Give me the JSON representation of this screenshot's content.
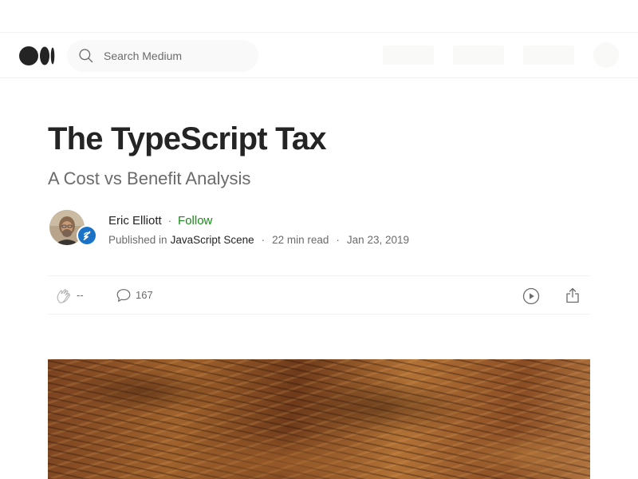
{
  "header": {
    "logo": "medium-logo",
    "search": {
      "placeholder": "Search Medium"
    }
  },
  "article": {
    "title": "The TypeScript Tax",
    "subtitle": "A Cost vs Benefit Analysis",
    "author": {
      "name": "Eric Elliott",
      "follow_label": "Follow",
      "separator": "·"
    },
    "meta": {
      "published_in_label": "Published in",
      "publication": "JavaScript Scene",
      "read_time": "22 min read",
      "date": "Jan 23, 2019",
      "separator": "·"
    },
    "actions": {
      "claps": "--",
      "comments": "167",
      "icons": [
        "clap-icon",
        "comment-icon",
        "play-icon",
        "share-icon"
      ]
    }
  },
  "colors": {
    "follow": "#1a8917",
    "text": "#242424",
    "muted": "#6b6b6b",
    "publication_badge": "#1a73c8"
  }
}
